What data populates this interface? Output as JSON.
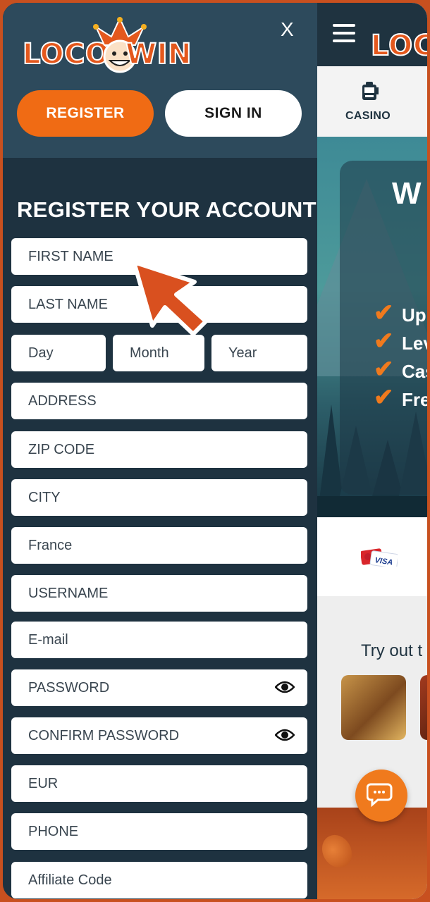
{
  "drawer": {
    "logo": {
      "part1": "LOCO",
      "part2": "WIN"
    },
    "close_label": "X",
    "register_button": "REGISTER",
    "signin_button": "SIGN IN",
    "form_title": "REGISTER YOUR ACCOUNT",
    "fields": {
      "first_name": "FIRST NAME",
      "last_name": "LAST NAME",
      "day": "Day",
      "month": "Month",
      "year": "Year",
      "address": "ADDRESS",
      "zip_code": "ZIP CODE",
      "city": "CITY",
      "country": "France",
      "username": "USERNAME",
      "email": "E-mail",
      "password": "PASSWORD",
      "confirm_password": "CONFIRM PASSWORD",
      "currency": "EUR",
      "phone": "PHONE",
      "affiliate_code": "Affiliate Code"
    }
  },
  "background_page": {
    "logo": "LOCO",
    "nav_casino": "CASINO",
    "hero_title": "W",
    "hero_items": [
      "Up",
      "Lev",
      "Cas",
      "Fre"
    ],
    "payment_card": "VISA",
    "tryout_text": "Try out t"
  },
  "colors": {
    "accent": "#f06b14",
    "drawer_bg": "#1e3240",
    "drawer_top": "#2d4a5c",
    "frame": "#c8501f"
  },
  "icons": [
    "close-icon",
    "jester-icon",
    "eye-icon",
    "menu-icon",
    "slot-machine-icon",
    "chat-icon",
    "pointer-arrow-icon"
  ]
}
